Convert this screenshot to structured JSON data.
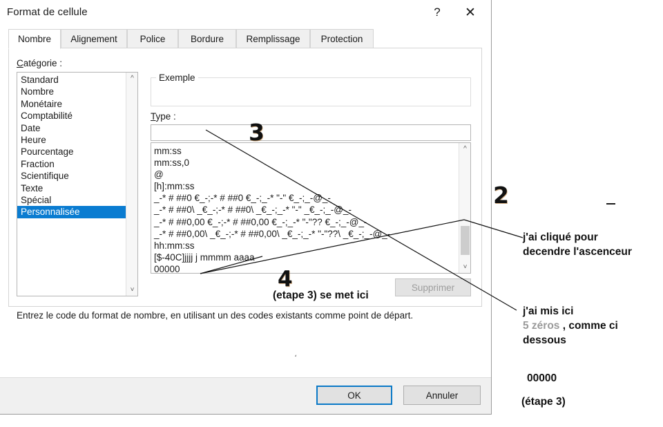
{
  "window": {
    "title": "Format de cellule",
    "help_icon": "?",
    "close_icon": "✕"
  },
  "tabs": [
    {
      "label": "Nombre",
      "active": true
    },
    {
      "label": "Alignement",
      "active": false
    },
    {
      "label": "Police",
      "active": false
    },
    {
      "label": "Bordure",
      "active": false
    },
    {
      "label": "Remplissage",
      "active": false
    },
    {
      "label": "Protection",
      "active": false
    }
  ],
  "category": {
    "label": "Catégorie :",
    "label_accesskey": "C",
    "selected": "Personnalisée",
    "items": [
      "Standard",
      "Nombre",
      "Monétaire",
      "Comptabilité",
      "Date",
      "Heure",
      "Pourcentage",
      "Fraction",
      "Scientifique",
      "Texte",
      "Spécial",
      "Personnalisée"
    ]
  },
  "example": {
    "legend": "Exemple",
    "value": ""
  },
  "type": {
    "label": "Type :",
    "label_accesskey": "T",
    "input_value": "",
    "input_placeholder": "",
    "items": [
      "mm:ss",
      "mm:ss,0",
      "@",
      "[h]:mm:ss",
      "_-* # ##0 €_-;-* # ##0 €_-;_-* \"-\" €_-;_-@_-",
      "_-* # ##0\\ _€_-;-* # ##0\\ _€_-;_-* \"-\" _€_-;_-@_-",
      "_-* # ##0,00 €_-;-* # ##0,00 €_-;_-* \"-\"?? €_-;_-@_-",
      "_-* # ##0,00\\ _€_-;-* # ##0,00\\ _€_-;_-* \"-\"??\\ _€_-;_-@_-",
      "hh:mm:ss",
      "[$-40C]jjjj j mmmm aaaa",
      "00000"
    ]
  },
  "buttons": {
    "supprimer": "Supprimer",
    "supprimer_enabled": false,
    "ok": "OK",
    "annuler": "Annuler"
  },
  "hint": "Entrez le code du format de nombre, en utilisant un des codes existants comme point de départ.",
  "annotations": {
    "num_2": "2",
    "num_3": "3",
    "num_4": "4",
    "note_scrollbar_line1": "j'ai cliqué pour",
    "note_scrollbar_line2": "decendre l'ascenceur",
    "note_step4_line": "(etape 3) se met ici",
    "note_ici_line1": "j'ai mis ici",
    "note_ici_grey": "5 zéros",
    "note_ici_rest": " , comme ci",
    "note_ici_line3": "dessous",
    "note_zeros": "00000",
    "note_etape3": "(étape 3)"
  },
  "colors": {
    "selection_blue": "#0a7cd1",
    "default_button_border": "#0a79c7",
    "dialog_chrome": "#f0f0f0",
    "annotation_grey": "#9a9a9a"
  }
}
